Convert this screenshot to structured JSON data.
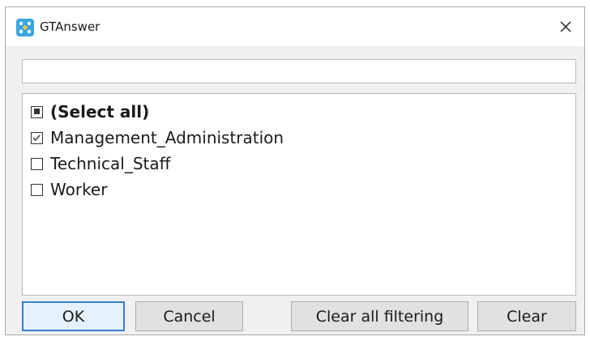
{
  "window": {
    "title": "GTAnswer",
    "app_icon": "app-icon",
    "close_icon": "close-icon",
    "close_glyph": "✕"
  },
  "search": {
    "value": "",
    "placeholder": ""
  },
  "list": {
    "items": [
      {
        "label": "(Select all)",
        "state": "partial",
        "bold": true
      },
      {
        "label": "Management_Administration",
        "state": "checked",
        "bold": false
      },
      {
        "label": "Technical_Staff",
        "state": "unchecked",
        "bold": false
      },
      {
        "label": "Worker",
        "state": "unchecked",
        "bold": false
      }
    ]
  },
  "buttons": {
    "ok": "OK",
    "cancel": "Cancel",
    "clear_all_filtering": "Clear all filtering",
    "clear": "Clear"
  },
  "colors": {
    "accent": "#3b7dc9",
    "app_icon": "#3aa6e0"
  }
}
